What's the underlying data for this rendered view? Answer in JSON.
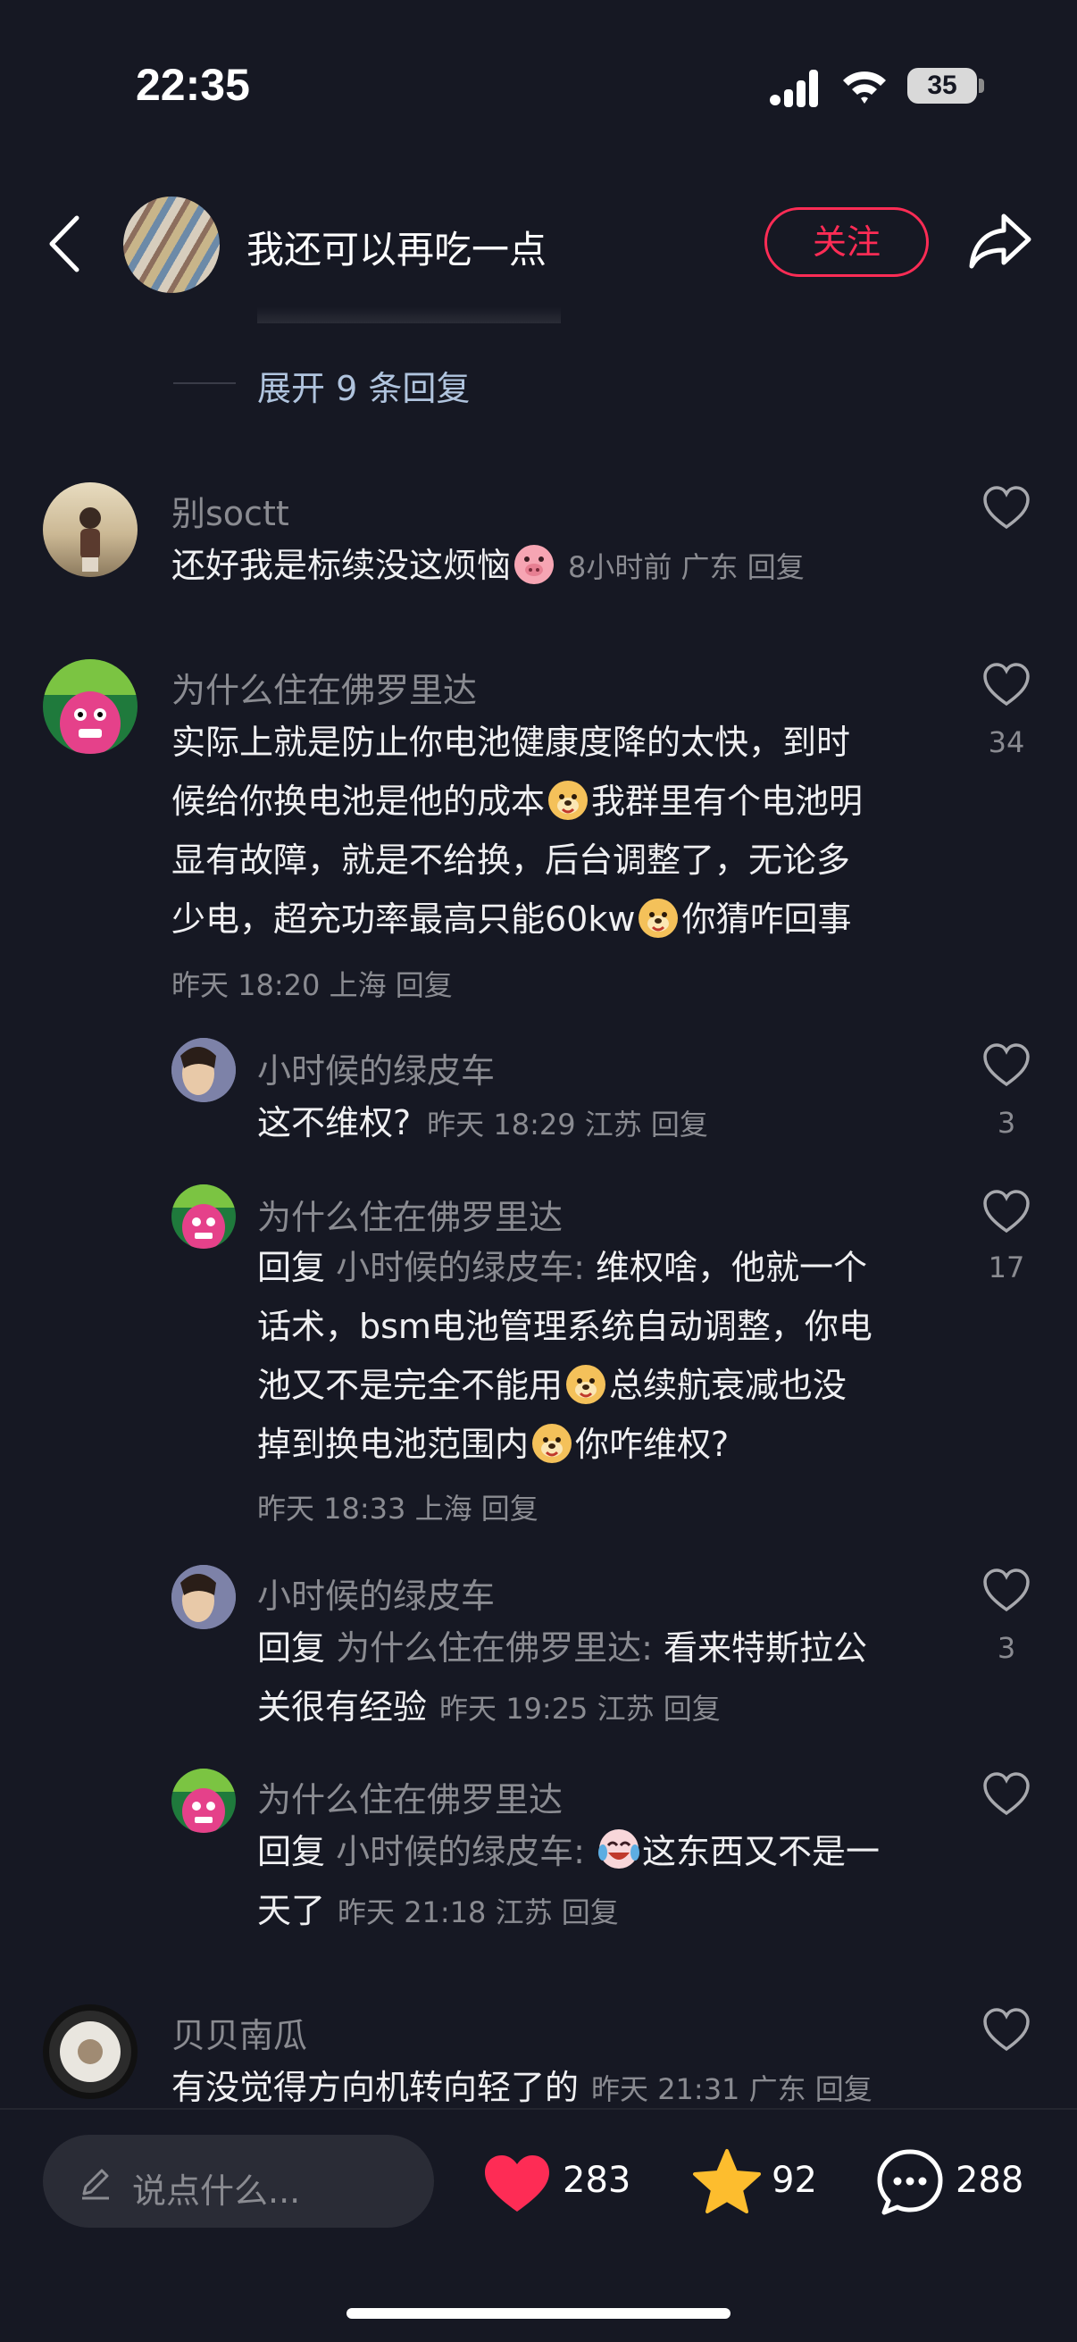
{
  "status_bar": {
    "time": "22:35",
    "battery": "35"
  },
  "header": {
    "title": "我还可以再吃一点",
    "follow_label": "关注"
  },
  "expand": {
    "label": "展开 9 条回复"
  },
  "comments": [
    {
      "name": "别soctt",
      "text": "还好我是标续没这烦恼",
      "meta": "8小时前 广东 回复"
    },
    {
      "name": "为什么住在佛罗里达",
      "lines": [
        "实际上就是防止你电池健康度降的太快，到时",
        "候给你换电池是他的成本",
        "我群里有个电池明",
        "显有故障，就是不给换，后台调整了，无论多",
        "少电，超充功率最高只能60kw",
        "你猜咋回事"
      ],
      "meta": "昨天 18:20 上海 回复",
      "likes": "34"
    }
  ],
  "replies": [
    {
      "name": "小时候的绿皮车",
      "text": "这不维权?",
      "meta": "昨天 18:29 江苏 回复",
      "likes": "3"
    },
    {
      "name": "为什么住在佛罗里达",
      "reply_prefix": "回复",
      "reply_to": "小时候的绿皮车:",
      "lines": [
        "维权啥，他就一个",
        "话术，bsm电池管理系统自动调整，你电",
        "池又不是完全不能用",
        "总续航衰减也没",
        "掉到换电池范围内",
        "你咋维权?"
      ],
      "meta": "昨天 18:33 上海 回复",
      "likes": "17"
    },
    {
      "name": "小时候的绿皮车",
      "reply_prefix": "回复",
      "reply_to": "为什么住在佛罗里达:",
      "lines": [
        "看来特斯拉公",
        "关很有经验"
      ],
      "meta": "昨天 19:25 江苏 回复",
      "likes": "3"
    },
    {
      "name": "为什么住在佛罗里达",
      "reply_prefix": "回复",
      "reply_to": "小时候的绿皮车:",
      "lines": [
        "这东西又不是一",
        "天了"
      ],
      "meta": "昨天 21:18 江苏 回复"
    }
  ],
  "last_comment": {
    "name": "贝贝南瓜",
    "text": "有没觉得方向机转向轻了的",
    "meta": "昨天 21:31 广东 回复"
  },
  "bottom_bar": {
    "placeholder": "说点什么...",
    "likes": "283",
    "favorites": "92",
    "comments": "288"
  },
  "colors": {
    "accent": "#fe2c55",
    "background": "#161823",
    "star": "#fdbd2e"
  },
  "icons": [
    "back-icon",
    "share-icon",
    "heart-icon",
    "star-icon",
    "comment-icon",
    "pencil-icon",
    "signal-icon",
    "wifi-icon"
  ]
}
